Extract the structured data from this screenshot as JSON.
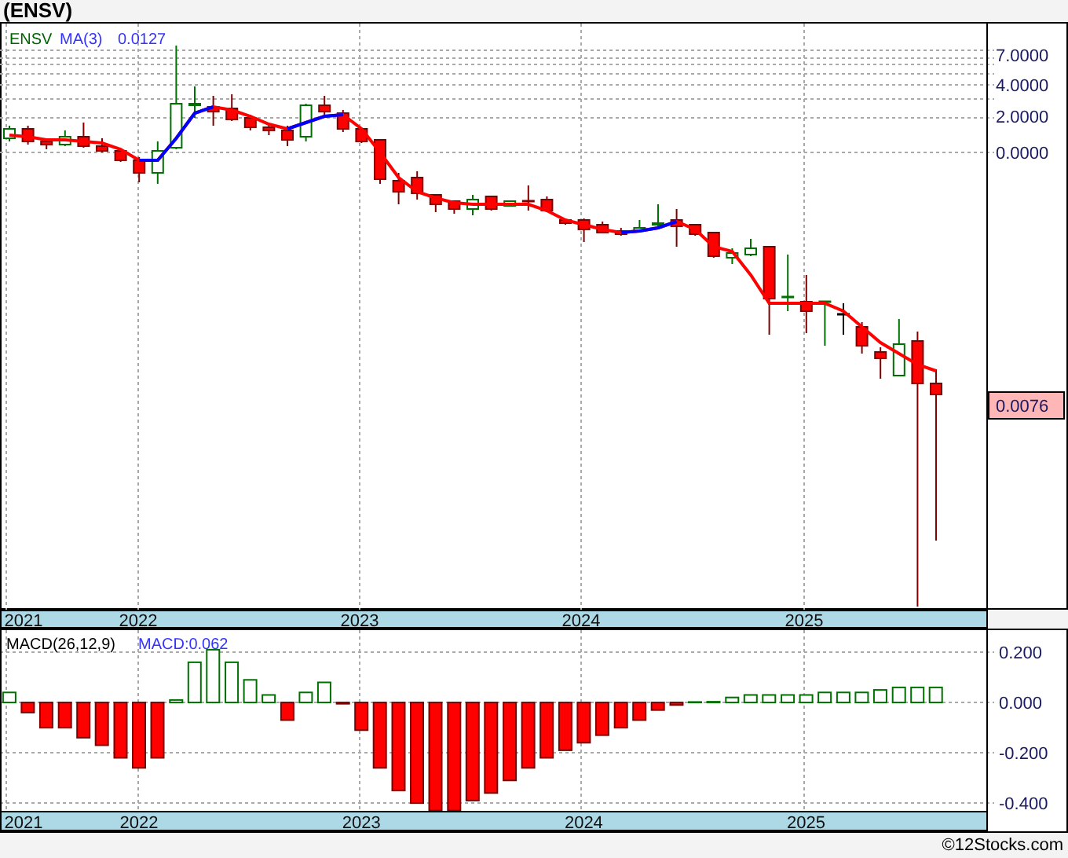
{
  "title": "(ENSV)",
  "price_chart": {
    "legend": {
      "symbol": "ENSV",
      "indicator": "MA(3)",
      "value": "0.0127"
    },
    "axis_labels": [
      "7.0000",
      "4.0000",
      "2.0000",
      "0.0000"
    ],
    "last_price": "0.0076",
    "year_labels": [
      "2021",
      "2022",
      "2023",
      "2024",
      "2025"
    ]
  },
  "macd_chart": {
    "legend": {
      "name": "MACD(26,12,9)",
      "value": "MACD:0.062"
    },
    "edge_year_label": "2021",
    "chart_data": {
      "type": "bar",
      "x": [
        2021.417,
        2021.5,
        2021.583,
        2021.667,
        2021.75,
        2021.833,
        2021.917,
        2022.0,
        2022.083,
        2022.167,
        2022.25,
        2022.333,
        2022.417,
        2022.5,
        2022.583,
        2022.667,
        2022.75,
        2022.833,
        2022.917,
        2023.0,
        2023.083,
        2023.167,
        2023.25,
        2023.333,
        2023.417,
        2023.5,
        2023.583,
        2023.667,
        2023.75,
        2023.833,
        2023.917,
        2024.0,
        2024.083,
        2024.167,
        2024.25,
        2024.333,
        2024.417,
        2024.5,
        2024.583,
        2024.667,
        2024.75,
        2024.833,
        2024.917,
        2025.0,
        2025.083,
        2025.167,
        2025.25,
        2025.333,
        2025.417,
        2025.5,
        2025.583
      ],
      "xlim": [
        2021.375,
        2025.81
      ],
      "grid": true,
      "values": [
        0.04,
        -0.04,
        -0.1,
        -0.1,
        -0.14,
        -0.17,
        -0.22,
        -0.26,
        -0.22,
        0.01,
        0.16,
        0.21,
        0.16,
        0.09,
        0.03,
        -0.07,
        0.04,
        0.08,
        -0.005,
        -0.11,
        -0.26,
        -0.35,
        -0.4,
        -0.43,
        -0.43,
        -0.39,
        -0.36,
        -0.31,
        -0.26,
        -0.22,
        -0.19,
        -0.16,
        -0.13,
        -0.1,
        -0.07,
        -0.03,
        -0.01,
        0.002,
        0.003,
        0.02,
        0.03,
        0.03,
        0.03,
        0.03,
        0.04,
        0.04,
        0.04,
        0.05,
        0.06,
        0.06,
        0.06
      ],
      "ylim": [
        -0.431,
        0.294
      ],
      "yticks": [
        {
          "value": 0.2,
          "label": "0.200"
        },
        {
          "value": 0,
          "label": "0.000"
        },
        {
          "value": -0.2,
          "label": "-0.200"
        },
        {
          "value": -0.4,
          "label": "-0.400"
        }
      ],
      "xticks": [
        2022,
        2023,
        2024,
        2025
      ]
    }
  },
  "footer": "©12Stocks.com"
}
